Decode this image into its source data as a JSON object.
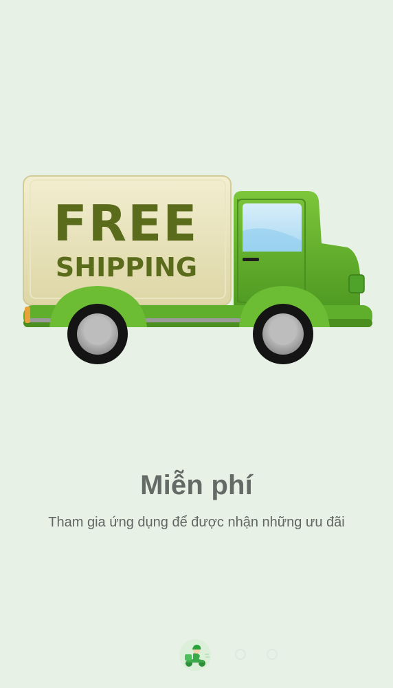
{
  "slide": {
    "illustration_text_line1": "FREE",
    "illustration_text_line2": "SHIPPING",
    "title": "Miễn phí",
    "description": "Tham gia ứng dụng để được nhận những ưu đãi"
  },
  "pager": {
    "total_pages": 3,
    "active_index": 0,
    "active_icon": "delivery-rider-icon"
  },
  "colors": {
    "background": "#e7f1e6",
    "truck_green": "#5fae2c",
    "cargo_cream": "#e6e0b4",
    "text_dark_green": "#5b6b1c",
    "title_gray": "#646a66"
  }
}
